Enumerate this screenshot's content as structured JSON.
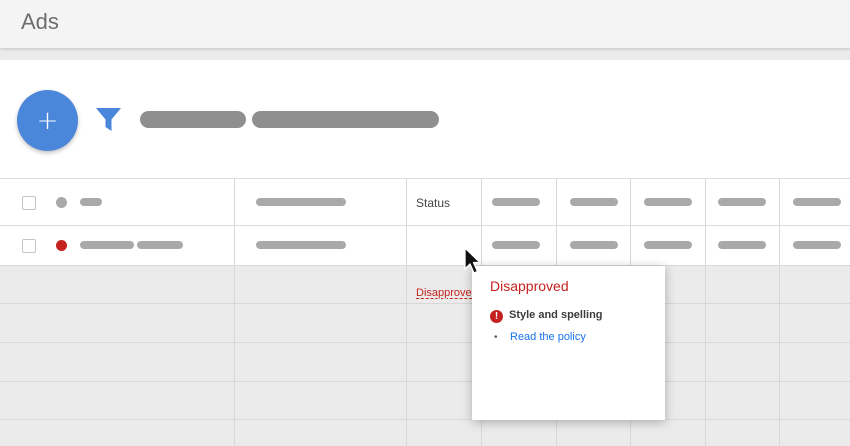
{
  "header": {
    "title": "Ads"
  },
  "toolbar": {
    "add_label": "+"
  },
  "table": {
    "status_header": "Status",
    "row": {
      "status": "Disapproved",
      "status_color": "#c5221f"
    }
  },
  "popup": {
    "title": "Disapproved",
    "error_icon": "!",
    "policy": "Style and spelling",
    "bullet": "•",
    "link": "Read the policy"
  },
  "colors": {
    "accent": "#4a86d9",
    "error": "#c5221f",
    "link": "#1a73e8"
  },
  "icons": [
    "add-icon",
    "filter-icon",
    "error-icon",
    "mouse-cursor-icon"
  ]
}
